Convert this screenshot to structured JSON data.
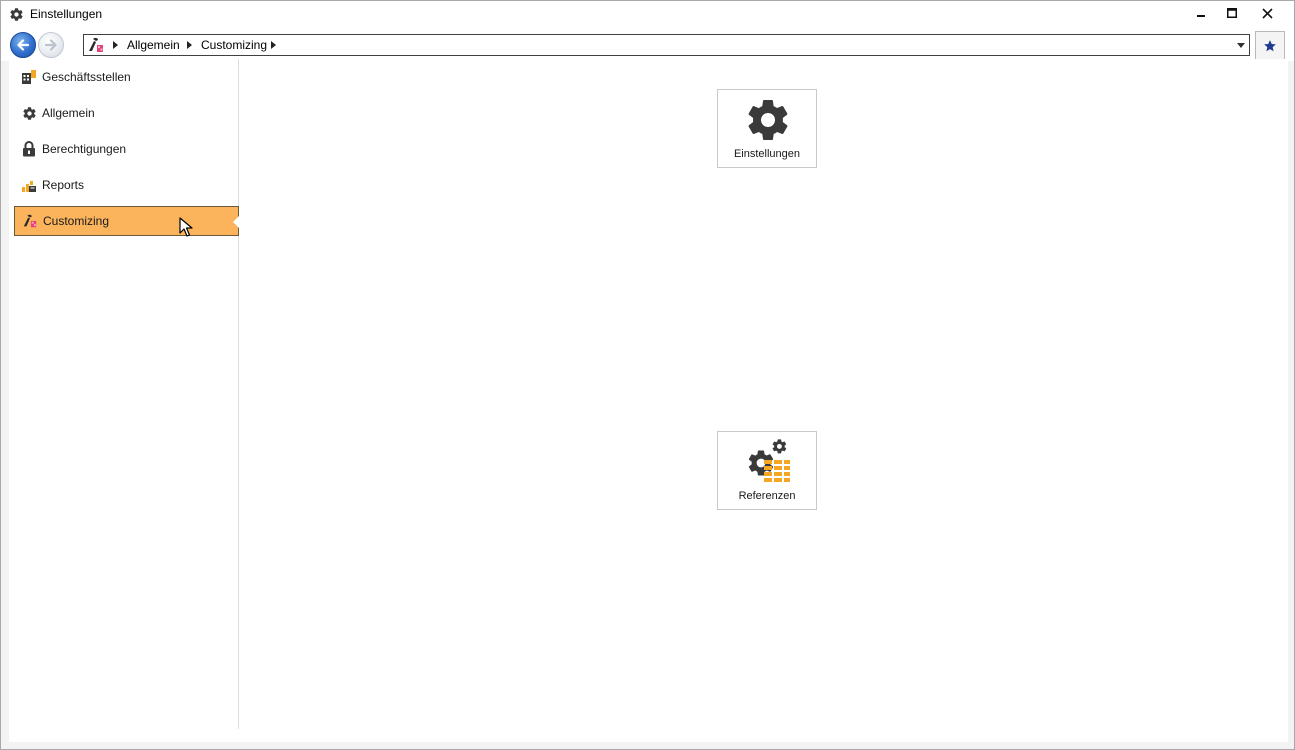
{
  "window": {
    "title": "Einstellungen"
  },
  "controls": {
    "minimize": "minimize",
    "maximize": "maximize",
    "close": "close"
  },
  "navbar": {
    "breadcrumb": [
      "Allgemein",
      "Customizing"
    ],
    "favorite": "favorite"
  },
  "sidebar": {
    "items": [
      {
        "label": "Geschäftsstellen",
        "icon": "office-building-icon"
      },
      {
        "label": "Allgemein",
        "icon": "gear-icon"
      },
      {
        "label": "Berechtigungen",
        "icon": "lock-icon"
      },
      {
        "label": "Reports",
        "icon": "reports-icon"
      },
      {
        "label": "Customizing",
        "icon": "customizing-icon",
        "active": true
      }
    ]
  },
  "tiles": [
    {
      "label": "Einstellungen",
      "icon": "gear-icon"
    },
    {
      "label": "Referenzen",
      "icon": "references-icon"
    }
  ],
  "colors": {
    "accent": "#fbb45c",
    "icon_dark": "#3a3a3a",
    "icon_orange": "#f5a623",
    "nav_blue": "#2f6fcf"
  }
}
